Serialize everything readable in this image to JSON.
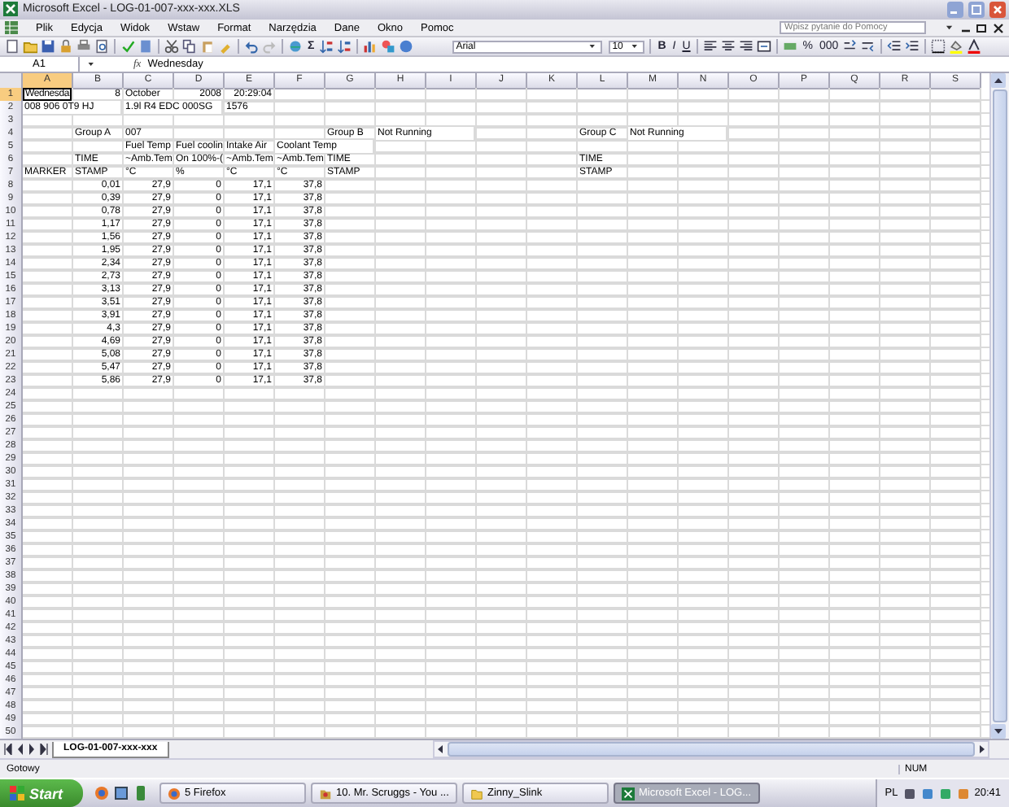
{
  "window": {
    "title": "Microsoft Excel - LOG-01-007-xxx-xxx.XLS"
  },
  "menu": [
    "Plik",
    "Edycja",
    "Widok",
    "Wstaw",
    "Format",
    "Narzędzia",
    "Dane",
    "Okno",
    "Pomoc"
  ],
  "help_box": {
    "placeholder": "Wpisz pytanie do Pomocy"
  },
  "toolbar": {
    "autosum": "Σ",
    "font": "Arial",
    "font_size": "10",
    "style_buttons": [
      "B",
      "I",
      "U"
    ],
    "number_buttons": [
      "%",
      "000"
    ]
  },
  "formula_bar": {
    "name_box": "A1",
    "function_label": "fx",
    "value": "Wednesday"
  },
  "sheet": {
    "columns": [
      "A",
      "B",
      "C",
      "D",
      "E",
      "F",
      "G",
      "H",
      "I",
      "J",
      "K",
      "L",
      "M",
      "N",
      "O",
      "P",
      "Q",
      "R",
      "S"
    ],
    "rows": [
      {
        "number": "1",
        "cells": [
          {
            "text": "Wednesda",
            "kind": "text",
            "selected": true
          },
          {
            "text": "8",
            "kind": "number"
          },
          {
            "text": "October",
            "kind": "text"
          },
          {
            "text": "2008",
            "kind": "number"
          },
          {
            "text": "20:29:04",
            "kind": "number"
          }
        ]
      },
      {
        "number": "2",
        "cells": [
          {
            "text": "008 906 0T9 HJ",
            "kind": "text",
            "spill": true
          },
          null,
          {
            "text": "1.9l R4 EDC 000SG",
            "kind": "text",
            "spill": true
          },
          null,
          {
            "text": "1576",
            "kind": "text"
          }
        ]
      },
      {
        "number": "3"
      },
      {
        "number": "4",
        "cells": [
          null,
          {
            "text": "Group A",
            "kind": "text"
          },
          {
            "text": "007",
            "kind": "text"
          },
          null,
          null,
          null,
          {
            "text": "Group B",
            "kind": "text"
          },
          {
            "text": "Not Running",
            "kind": "text",
            "spill": true
          },
          null,
          null,
          null,
          {
            "text": "Group C",
            "kind": "text"
          },
          {
            "text": "Not Running",
            "kind": "text",
            "spill": true
          }
        ]
      },
      {
        "number": "5",
        "cells": [
          null,
          null,
          {
            "text": "Fuel Temp",
            "kind": "text"
          },
          {
            "text": "Fuel coolin",
            "kind": "text"
          },
          {
            "text": "Intake Air",
            "kind": "text"
          },
          {
            "text": "Coolant Temp",
            "kind": "text",
            "spill": true
          }
        ]
      },
      {
        "number": "6",
        "cells": [
          null,
          {
            "text": "TIME",
            "kind": "text"
          },
          {
            "text": "~Amb.Tem",
            "kind": "text"
          },
          {
            "text": "On 100%-(",
            "kind": "text"
          },
          {
            "text": "~Amb.Tem",
            "kind": "text"
          },
          {
            "text": "~Amb.Tem",
            "kind": "text"
          },
          {
            "text": "TIME",
            "kind": "text"
          },
          null,
          null,
          null,
          null,
          {
            "text": "TIME",
            "kind": "text"
          }
        ]
      },
      {
        "number": "7",
        "cells": [
          {
            "text": "MARKER",
            "kind": "text"
          },
          {
            "text": "STAMP",
            "kind": "text"
          },
          {
            "text": "°C",
            "kind": "text"
          },
          {
            "text": "%",
            "kind": "text"
          },
          {
            "text": "°C",
            "kind": "text"
          },
          {
            "text": "°C",
            "kind": "text"
          },
          {
            "text": "STAMP",
            "kind": "text"
          },
          null,
          null,
          null,
          null,
          {
            "text": "STAMP",
            "kind": "text"
          }
        ]
      },
      {
        "number": "8",
        "cells": [
          null,
          {
            "text": "0,01",
            "kind": "number"
          },
          {
            "text": "27,9",
            "kind": "number"
          },
          {
            "text": "0",
            "kind": "number"
          },
          {
            "text": "17,1",
            "kind": "number"
          },
          {
            "text": "37,8",
            "kind": "number"
          }
        ]
      },
      {
        "number": "9",
        "cells": [
          null,
          {
            "text": "0,39",
            "kind": "number"
          },
          {
            "text": "27,9",
            "kind": "number"
          },
          {
            "text": "0",
            "kind": "number"
          },
          {
            "text": "17,1",
            "kind": "number"
          },
          {
            "text": "37,8",
            "kind": "number"
          }
        ]
      },
      {
        "number": "10",
        "cells": [
          null,
          {
            "text": "0,78",
            "kind": "number"
          },
          {
            "text": "27,9",
            "kind": "number"
          },
          {
            "text": "0",
            "kind": "number"
          },
          {
            "text": "17,1",
            "kind": "number"
          },
          {
            "text": "37,8",
            "kind": "number"
          }
        ]
      },
      {
        "number": "11",
        "cells": [
          null,
          {
            "text": "1,17",
            "kind": "number"
          },
          {
            "text": "27,9",
            "kind": "number"
          },
          {
            "text": "0",
            "kind": "number"
          },
          {
            "text": "17,1",
            "kind": "number"
          },
          {
            "text": "37,8",
            "kind": "number"
          }
        ]
      },
      {
        "number": "12",
        "cells": [
          null,
          {
            "text": "1,56",
            "kind": "number"
          },
          {
            "text": "27,9",
            "kind": "number"
          },
          {
            "text": "0",
            "kind": "number"
          },
          {
            "text": "17,1",
            "kind": "number"
          },
          {
            "text": "37,8",
            "kind": "number"
          }
        ]
      },
      {
        "number": "13",
        "cells": [
          null,
          {
            "text": "1,95",
            "kind": "number"
          },
          {
            "text": "27,9",
            "kind": "number"
          },
          {
            "text": "0",
            "kind": "number"
          },
          {
            "text": "17,1",
            "kind": "number"
          },
          {
            "text": "37,8",
            "kind": "number"
          }
        ]
      },
      {
        "number": "14",
        "cells": [
          null,
          {
            "text": "2,34",
            "kind": "number"
          },
          {
            "text": "27,9",
            "kind": "number"
          },
          {
            "text": "0",
            "kind": "number"
          },
          {
            "text": "17,1",
            "kind": "number"
          },
          {
            "text": "37,8",
            "kind": "number"
          }
        ]
      },
      {
        "number": "15",
        "cells": [
          null,
          {
            "text": "2,73",
            "kind": "number"
          },
          {
            "text": "27,9",
            "kind": "number"
          },
          {
            "text": "0",
            "kind": "number"
          },
          {
            "text": "17,1",
            "kind": "number"
          },
          {
            "text": "37,8",
            "kind": "number"
          }
        ]
      },
      {
        "number": "16",
        "cells": [
          null,
          {
            "text": "3,13",
            "kind": "number"
          },
          {
            "text": "27,9",
            "kind": "number"
          },
          {
            "text": "0",
            "kind": "number"
          },
          {
            "text": "17,1",
            "kind": "number"
          },
          {
            "text": "37,8",
            "kind": "number"
          }
        ]
      },
      {
        "number": "17",
        "cells": [
          null,
          {
            "text": "3,51",
            "kind": "number"
          },
          {
            "text": "27,9",
            "kind": "number"
          },
          {
            "text": "0",
            "kind": "number"
          },
          {
            "text": "17,1",
            "kind": "number"
          },
          {
            "text": "37,8",
            "kind": "number"
          }
        ]
      },
      {
        "number": "18",
        "cells": [
          null,
          {
            "text": "3,91",
            "kind": "number"
          },
          {
            "text": "27,9",
            "kind": "number"
          },
          {
            "text": "0",
            "kind": "number"
          },
          {
            "text": "17,1",
            "kind": "number"
          },
          {
            "text": "37,8",
            "kind": "number"
          }
        ]
      },
      {
        "number": "19",
        "cells": [
          null,
          {
            "text": "4,3",
            "kind": "number"
          },
          {
            "text": "27,9",
            "kind": "number"
          },
          {
            "text": "0",
            "kind": "number"
          },
          {
            "text": "17,1",
            "kind": "number"
          },
          {
            "text": "37,8",
            "kind": "number"
          }
        ]
      },
      {
        "number": "20",
        "cells": [
          null,
          {
            "text": "4,69",
            "kind": "number"
          },
          {
            "text": "27,9",
            "kind": "number"
          },
          {
            "text": "0",
            "kind": "number"
          },
          {
            "text": "17,1",
            "kind": "number"
          },
          {
            "text": "37,8",
            "kind": "number"
          }
        ]
      },
      {
        "number": "21",
        "cells": [
          null,
          {
            "text": "5,08",
            "kind": "number"
          },
          {
            "text": "27,9",
            "kind": "number"
          },
          {
            "text": "0",
            "kind": "number"
          },
          {
            "text": "17,1",
            "kind": "number"
          },
          {
            "text": "37,8",
            "kind": "number"
          }
        ]
      },
      {
        "number": "22",
        "cells": [
          null,
          {
            "text": "5,47",
            "kind": "number"
          },
          {
            "text": "27,9",
            "kind": "number"
          },
          {
            "text": "0",
            "kind": "number"
          },
          {
            "text": "17,1",
            "kind": "number"
          },
          {
            "text": "37,8",
            "kind": "number"
          }
        ]
      },
      {
        "number": "23",
        "cells": [
          null,
          {
            "text": "5,86",
            "kind": "number"
          },
          {
            "text": "27,9",
            "kind": "number"
          },
          {
            "text": "0",
            "kind": "number"
          },
          {
            "text": "17,1",
            "kind": "number"
          },
          {
            "text": "37,8",
            "kind": "number"
          }
        ]
      },
      {
        "number": "24"
      },
      {
        "number": "25"
      },
      {
        "number": "26"
      },
      {
        "number": "27"
      },
      {
        "number": "28"
      },
      {
        "number": "29"
      },
      {
        "number": "30"
      },
      {
        "number": "31"
      },
      {
        "number": "32"
      },
      {
        "number": "33"
      },
      {
        "number": "34"
      },
      {
        "number": "35"
      },
      {
        "number": "36"
      },
      {
        "number": "37"
      },
      {
        "number": "38"
      },
      {
        "number": "39"
      },
      {
        "number": "40"
      },
      {
        "number": "41"
      },
      {
        "number": "42"
      },
      {
        "number": "43"
      },
      {
        "number": "44"
      },
      {
        "number": "45"
      },
      {
        "number": "46"
      },
      {
        "number": "47"
      },
      {
        "number": "48"
      },
      {
        "number": "49"
      },
      {
        "number": "50"
      }
    ]
  },
  "sheet_tabs": [
    {
      "label": "LOG-01-007-xxx-xxx",
      "selected": true
    }
  ],
  "status_bar": {
    "left": "Gotowy",
    "right": "NUM"
  },
  "taskbar": {
    "start": "Start",
    "tasks": [
      {
        "label": "5 Firefox",
        "selected": false
      },
      {
        "label": "10. Mr. Scruggs - You ...",
        "selected": false
      },
      {
        "label": "Zinny_Slink",
        "selected": false
      },
      {
        "label": "Microsoft Excel - LOG...",
        "selected": true
      }
    ],
    "language": "PL",
    "clock": "20:41"
  }
}
